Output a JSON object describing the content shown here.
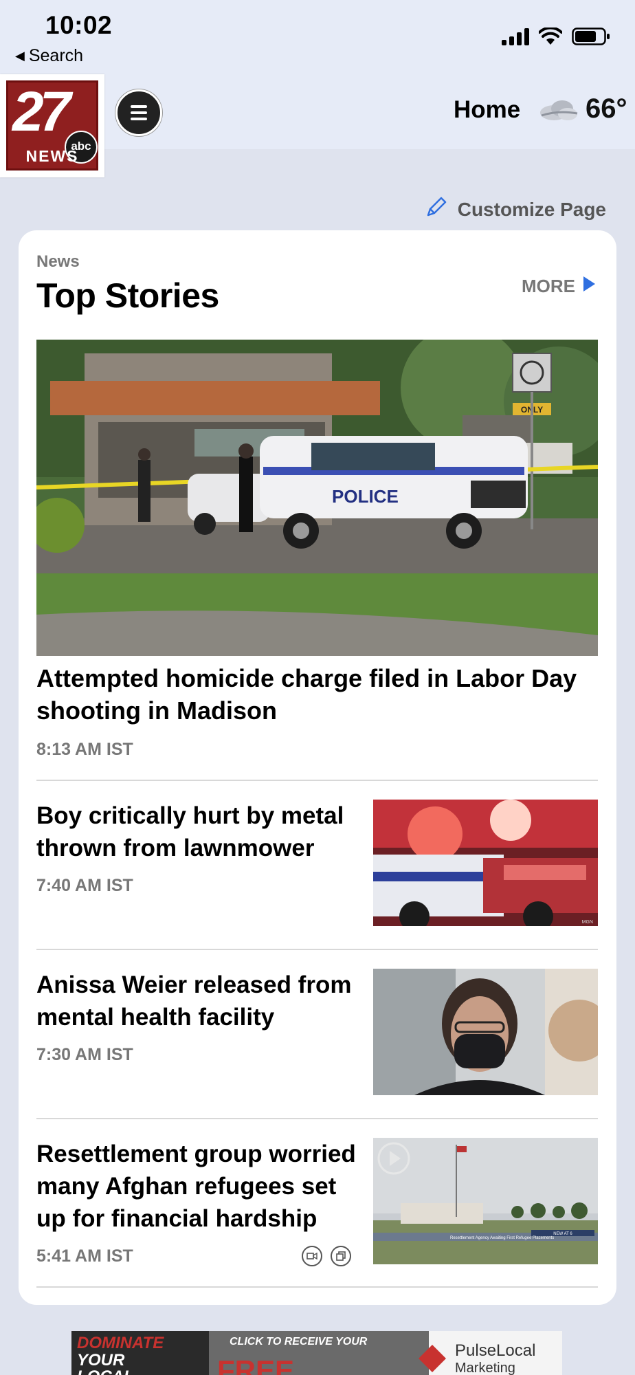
{
  "status_bar": {
    "time": "10:02",
    "back_label": "Search"
  },
  "header": {
    "logo_number": "27",
    "logo_network": "abc",
    "logo_word": "NEWS",
    "nav_label": "Home",
    "temperature": "66°",
    "weather_icon": "cloudy-icon"
  },
  "customize_label": "Customize Page",
  "section": {
    "kicker": "News",
    "title": "Top Stories",
    "more_label": "MORE"
  },
  "stories": [
    {
      "title": "Attempted homicide charge filed in Labor Day shooting in Madison",
      "time": "8:13 AM IST"
    },
    {
      "title": "Boy critically hurt by metal thrown from lawnmower",
      "time": "7:40 AM IST"
    },
    {
      "title": "Anissa Weier released from mental health facility",
      "time": "7:30 AM IST"
    },
    {
      "title": "Resettlement group worried many Afghan refugees set up for financial hardship",
      "time": "5:41 AM IST"
    }
  ],
  "image_text": {
    "police_car": "POLICE",
    "sign": "ONLY",
    "news_banner": "NEW AT 6",
    "ticker": "Resettlement Agency Awaiting First Refugee Placements",
    "watermark": "MGN"
  },
  "ad": {
    "left_line1": "DOMINATE",
    "left_line2": "YOUR",
    "left_line3": "LOCAL",
    "middle_line1": "CLICK TO RECEIVE YOUR",
    "middle_line2": "FREE",
    "right_brand": "PulseLocal",
    "right_sub": "Marketing"
  },
  "colors": {
    "accent_blue": "#2f6fe0",
    "logo_red": "#8f1f1f",
    "header_bg": "#e6ebf7"
  }
}
